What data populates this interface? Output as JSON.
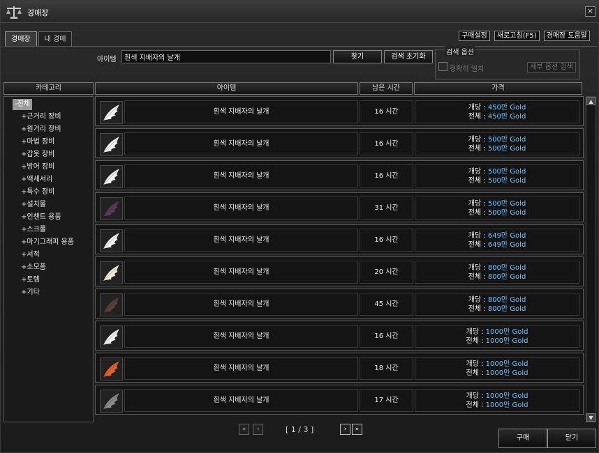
{
  "window": {
    "title": "경매장"
  },
  "tabs": [
    {
      "label": "경매장",
      "active": true
    },
    {
      "label": "내 경매",
      "active": false
    }
  ],
  "top_buttons": {
    "purchase_settings": "구매설정",
    "refresh": "새로고침(F5)",
    "help": "경매장 도움말"
  },
  "search": {
    "label": "아이템",
    "value": "흰색 지배자의 날개",
    "find_button": "찾기",
    "reset_button": "검색 초기화",
    "options_title": "검색 옵션",
    "exact_match_label": "정확히 일치",
    "exact_match_checked": false,
    "detail_search_button": "세부 옵션 검색"
  },
  "columns": {
    "category": "카테고리",
    "item": "아이템",
    "time_left": "남은 시간",
    "price": "가격"
  },
  "categories": [
    {
      "label": "-전체",
      "selected": true
    },
    {
      "label": "+근거리 장비"
    },
    {
      "label": "+원거리 장비"
    },
    {
      "label": "+마법 장비"
    },
    {
      "label": "+갑옷 장비"
    },
    {
      "label": "+방어 장비"
    },
    {
      "label": "+액세서리"
    },
    {
      "label": "+특수 장비"
    },
    {
      "label": "+설치물"
    },
    {
      "label": "+인챈트 용품"
    },
    {
      "label": "+스크롤"
    },
    {
      "label": "+마기그래피 용품"
    },
    {
      "label": "+서적"
    },
    {
      "label": "+소모품"
    },
    {
      "label": "+토템"
    },
    {
      "label": "+기타"
    }
  ],
  "price_labels": {
    "unit": "개당 :",
    "total": "전체 :"
  },
  "items": [
    {
      "name": "흰색 지배자의 날개",
      "time_left": "16 시간",
      "unit_price": "450만 Gold",
      "total_price": "450만 Gold",
      "wing_color": "#f2f2f2"
    },
    {
      "name": "흰색 지배자의 날개",
      "time_left": "16 시간",
      "unit_price": "500만 Gold",
      "total_price": "500만 Gold",
      "wing_color": "#f2f2f2"
    },
    {
      "name": "흰색 지배자의 날개",
      "time_left": "16 시간",
      "unit_price": "500만 Gold",
      "total_price": "500만 Gold",
      "wing_color": "#f2f2f2"
    },
    {
      "name": "흰색 지배자의 날개",
      "time_left": "31 시간",
      "unit_price": "500만 Gold",
      "total_price": "500만 Gold",
      "wing_color": "#5a3a5a"
    },
    {
      "name": "흰색 지배자의 날개",
      "time_left": "16 시간",
      "unit_price": "649만 Gold",
      "total_price": "649만 Gold",
      "wing_color": "#f2f2f2"
    },
    {
      "name": "흰색 지배자의 날개",
      "time_left": "20 시간",
      "unit_price": "800만 Gold",
      "total_price": "800만 Gold",
      "wing_color": "#f3ead0"
    },
    {
      "name": "흰색 지배자의 날개",
      "time_left": "45 시간",
      "unit_price": "800만 Gold",
      "total_price": "800만 Gold",
      "wing_color": "#5a3f36"
    },
    {
      "name": "흰색 지배자의 날개",
      "time_left": "16 시간",
      "unit_price": "1000만 Gold",
      "total_price": "1000만 Gold",
      "wing_color": "#f2f2f2"
    },
    {
      "name": "흰색 지배자의 날개",
      "time_left": "18 시간",
      "unit_price": "1000만 Gold",
      "total_price": "1000만 Gold",
      "wing_color": "#e2622a"
    },
    {
      "name": "흰색 지배자의 날개",
      "time_left": "17 시간",
      "unit_price": "1000만 Gold",
      "total_price": "1000만 Gold",
      "wing_color": "#8a8a8a"
    }
  ],
  "pagination": {
    "text": "[ 1 / 3 ]"
  },
  "bottom_buttons": {
    "buy": "구매",
    "close": "닫기"
  },
  "colors": {
    "gold_text": "#6fc4ff",
    "selected_category_bg": "#9a9a9a"
  }
}
